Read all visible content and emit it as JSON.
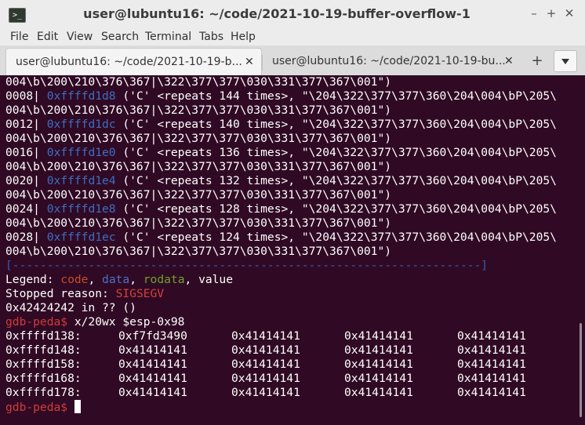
{
  "window": {
    "title": "user@lubuntu16: ~/code/2021-10-19-buffer-overflow-1",
    "app_icon_glyph": ">_",
    "buttons": {
      "minimize": "–",
      "maximize": "+",
      "close": "✕"
    }
  },
  "menu": [
    "File",
    "Edit",
    "View",
    "Search",
    "Terminal",
    "Tabs",
    "Help"
  ],
  "tabs": [
    {
      "label": "user@lubuntu16: ~/code/2021-10-19-b...",
      "close": "✕",
      "active": true
    },
    {
      "label": "user@lubuntu16: ~/code/2021-10-19-bu...",
      "close": "✕",
      "active": false
    }
  ],
  "tabbar": {
    "new_tab": "+"
  },
  "terminal": {
    "stack_lines": [
      {
        "cont": "004\\b\\200\\210\\376\\367|\\322\\377\\377\\030\\331\\377\\367\\001\")"
      },
      {
        "idx": "0008|",
        "addr": "0xffffd1d8",
        "rest": " ('C' <repeats 144 times>, \"\\204\\322\\377\\377\\360\\204\\004\\bP\\205\\"
      },
      {
        "cont": "004\\b\\200\\210\\376\\367|\\322\\377\\377\\030\\331\\377\\367\\001\")"
      },
      {
        "idx": "0012|",
        "addr": "0xffffd1dc",
        "rest": " ('C' <repeats 140 times>, \"\\204\\322\\377\\377\\360\\204\\004\\bP\\205\\"
      },
      {
        "cont": "004\\b\\200\\210\\376\\367|\\322\\377\\377\\030\\331\\377\\367\\001\")"
      },
      {
        "idx": "0016|",
        "addr": "0xffffd1e0",
        "rest": " ('C' <repeats 136 times>, \"\\204\\322\\377\\377\\360\\204\\004\\bP\\205\\"
      },
      {
        "cont": "004\\b\\200\\210\\376\\367|\\322\\377\\377\\030\\331\\377\\367\\001\")"
      },
      {
        "idx": "0020|",
        "addr": "0xffffd1e4",
        "rest": " ('C' <repeats 132 times>, \"\\204\\322\\377\\377\\360\\204\\004\\bP\\205\\"
      },
      {
        "cont": "004\\b\\200\\210\\376\\367|\\322\\377\\377\\030\\331\\377\\367\\001\")"
      },
      {
        "idx": "0024|",
        "addr": "0xffffd1e8",
        "rest": " ('C' <repeats 128 times>, \"\\204\\322\\377\\377\\360\\204\\004\\bP\\205\\"
      },
      {
        "cont": "004\\b\\200\\210\\376\\367|\\322\\377\\377\\030\\331\\377\\367\\001\")"
      },
      {
        "idx": "0028|",
        "addr": "0xffffd1ec",
        "rest": " ('C' <repeats 124 times>, \"\\204\\322\\377\\377\\360\\204\\004\\bP\\205\\"
      },
      {
        "cont": "004\\b\\200\\210\\376\\367|\\322\\377\\377\\030\\331\\377\\367\\001\")"
      }
    ],
    "separator": "[--------------------------------------------------------------------]",
    "legend": {
      "label": "Legend: ",
      "code": "code",
      "comma1": ", ",
      "data": "data",
      "comma2": ", ",
      "rodata": "rodata",
      "comma3": ", ",
      "value": "value"
    },
    "stopped": {
      "label": "Stopped reason: ",
      "reason": "SIGSEGV"
    },
    "crash_line": "0x42424242 in ?? ()",
    "prompt": "gdb-peda$",
    "command": " x/20wx $esp-0x98",
    "dump": [
      {
        "addr": "0xffffd138:",
        "w1": "0xf7fd3490",
        "w2": "0x41414141",
        "w3": "0x41414141",
        "w4": "0x41414141"
      },
      {
        "addr": "0xffffd148:",
        "w1": "0x41414141",
        "w2": "0x41414141",
        "w3": "0x41414141",
        "w4": "0x41414141"
      },
      {
        "addr": "0xffffd158:",
        "w1": "0x41414141",
        "w2": "0x41414141",
        "w3": "0x41414141",
        "w4": "0x41414141"
      },
      {
        "addr": "0xffffd168:",
        "w1": "0x41414141",
        "w2": "0x41414141",
        "w3": "0x41414141",
        "w4": "0x41414141"
      },
      {
        "addr": "0xffffd178:",
        "w1": "0x41414141",
        "w2": "0x41414141",
        "w3": "0x41414141",
        "w4": "0x41414141"
      }
    ]
  },
  "colors": {
    "terminal_bg": "#300a24",
    "address": "#3e6ec2",
    "code": "#c44c2c",
    "data": "#4a72c8",
    "rodata": "#6fa02e",
    "signal": "#d6403c",
    "prompt": "#d33b3b"
  }
}
